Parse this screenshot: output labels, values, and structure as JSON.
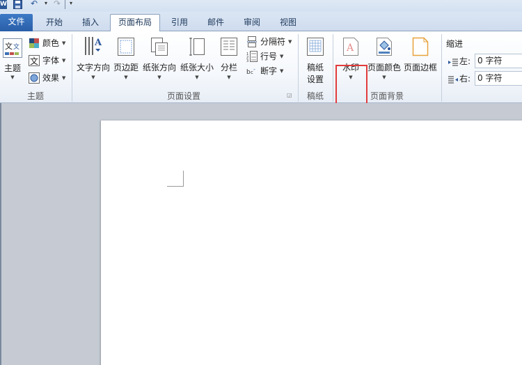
{
  "quick_access": {
    "word_icon": "W",
    "undo_icon": "undo-icon",
    "redo_icon": "redo-icon"
  },
  "tabs": [
    {
      "label": "文件"
    },
    {
      "label": "开始"
    },
    {
      "label": "插入"
    },
    {
      "label": "页面布局"
    },
    {
      "label": "引用"
    },
    {
      "label": "邮件"
    },
    {
      "label": "审阅"
    },
    {
      "label": "视图"
    }
  ],
  "ribbon": {
    "theme_group": {
      "label": "主题",
      "theme_button": "主题",
      "colors": "颜色",
      "fonts": "字体",
      "effects": "效果"
    },
    "page_setup_group": {
      "label": "页面设置",
      "text_direction": "文字方向",
      "margins": "页边距",
      "orientation": "纸张方向",
      "size": "纸张大小",
      "columns": "分栏",
      "breaks": "分隔符",
      "line_numbers": "行号",
      "hyphenation": "断字"
    },
    "manuscript_group": {
      "label": "稿纸",
      "settings_line1": "稿纸",
      "settings_line2": "设置"
    },
    "page_background_group": {
      "label": "页面背景",
      "watermark": "水印",
      "page_color": "页面颜色",
      "page_borders": "页面边框"
    },
    "indent": {
      "title": "缩进",
      "left_label": "左:",
      "left_value": "0 字符",
      "right_label": "右:",
      "right_value": "0 字符"
    }
  },
  "colors": {
    "file_tab": "#2a5ea8",
    "highlight": "#e23b3b",
    "ribbon_text": "#222222"
  }
}
